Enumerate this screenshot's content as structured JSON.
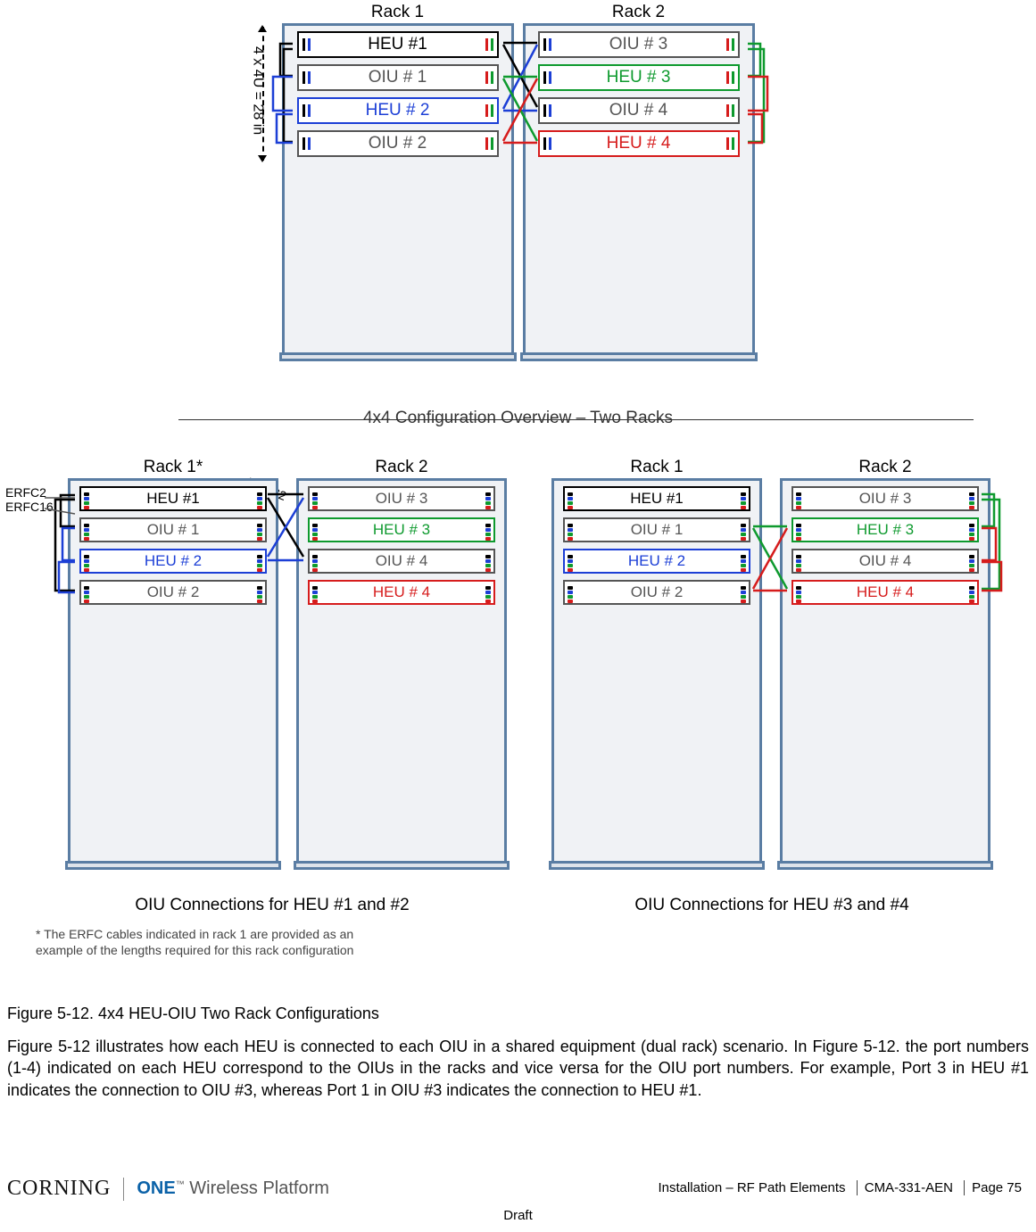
{
  "top": {
    "rack1": {
      "title": "Rack 1",
      "u": [
        {
          "t": "HEU #1",
          "c": "bk"
        },
        {
          "t": "OIU # 1",
          "c": "gr"
        },
        {
          "t": "HEU # 2",
          "c": "bl"
        },
        {
          "t": "OIU # 2",
          "c": "gr"
        }
      ]
    },
    "rack2": {
      "title": "Rack 2",
      "u": [
        {
          "t": "OIU # 3",
          "c": "gr"
        },
        {
          "t": "HEU # 3",
          "c": "gn"
        },
        {
          "t": "OIU # 4",
          "c": "gr"
        },
        {
          "t": "HEU # 4",
          "c": "rd"
        }
      ]
    },
    "dim": "4 x 4U = 28 in",
    "caption": "4x4 Configuration Overview – Two Racks"
  },
  "bottomLeft": {
    "rack1": {
      "title": "Rack 1*",
      "u": [
        {
          "t": "HEU #1",
          "c": "bk"
        },
        {
          "t": "OIU # 1",
          "c": "gr"
        },
        {
          "t": "HEU # 2",
          "c": "bl"
        },
        {
          "t": "OIU # 2",
          "c": "gr"
        }
      ]
    },
    "rack2": {
      "title": "Rack 2",
      "u": [
        {
          "t": "OIU # 3",
          "c": "gr"
        },
        {
          "t": "HEU # 3",
          "c": "gn"
        },
        {
          "t": "OIU # 4",
          "c": "gr"
        },
        {
          "t": "HEU # 4",
          "c": "rd"
        }
      ]
    },
    "caption": "OIU Connections for HEU #1 and #2",
    "erfc_a": "ERFC2",
    "erfc_b": "ERFC16",
    "erfc_c": "ERFC2",
    "footnote": "* The ERFC cables indicated in rack 1 are provided as an example of the lengths required for this rack configuration"
  },
  "bottomRight": {
    "rack1": {
      "title": "Rack 1",
      "u": [
        {
          "t": "HEU #1",
          "c": "bk"
        },
        {
          "t": "OIU # 1",
          "c": "gr"
        },
        {
          "t": "HEU # 2",
          "c": "bl"
        },
        {
          "t": "OIU # 2",
          "c": "gr"
        }
      ]
    },
    "rack2": {
      "title": "Rack 2",
      "u": [
        {
          "t": "OIU # 3",
          "c": "gr"
        },
        {
          "t": "HEU # 3",
          "c": "gn"
        },
        {
          "t": "OIU # 4",
          "c": "gr"
        },
        {
          "t": "HEU # 4",
          "c": "rd"
        }
      ]
    },
    "caption": "OIU Connections for HEU #3 and #4"
  },
  "figureTitle": "Figure 5-12. 4x4 HEU-OIU Two Rack Configurations",
  "bodyPara": "Figure 5-12 illustrates how each HEU is connected to each OIU in a shared equipment (dual rack) scenario. In Figure 5-12. the port numbers (1-4) indicated on each HEU correspond to the OIUs in the racks and vice versa for the OIU port numbers. For example, Port 3 in HEU #1 indicates the connection to OIU #3, whereas Port 1 in OIU #3 indicates the connection to HEU #1.",
  "footer": {
    "brand": "CORNING",
    "platform_accent": "ONE",
    "platform_tm": "™",
    "platform_rest": " Wireless Platform",
    "section": "Installation – RF Path Elements",
    "docnum": "CMA-331-AEN",
    "page": "Page 75",
    "draft": "Draft"
  }
}
